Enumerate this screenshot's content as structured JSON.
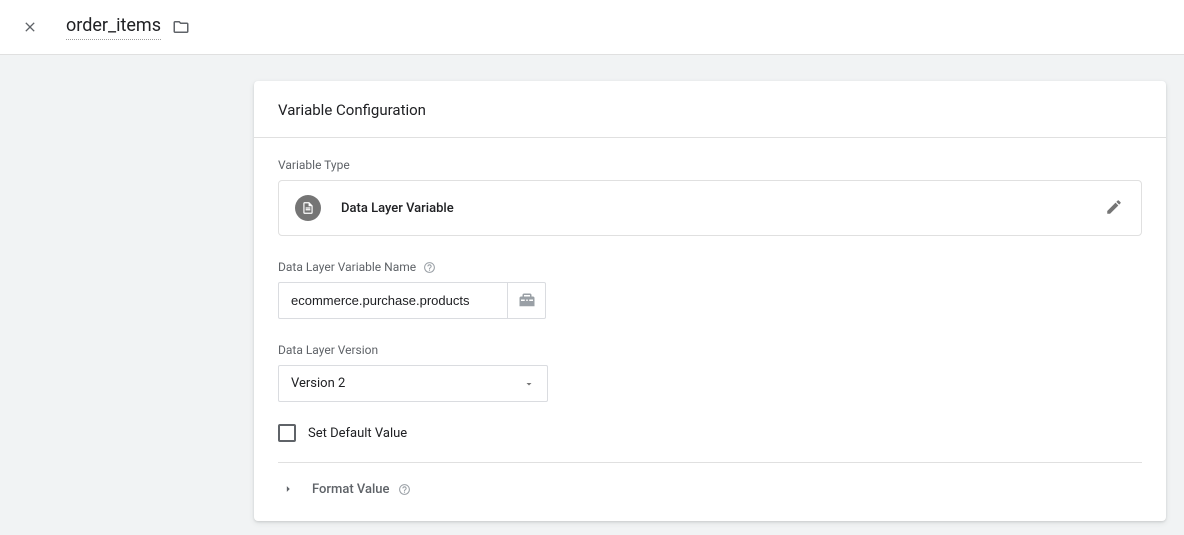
{
  "header": {
    "title": "order_items"
  },
  "card": {
    "title": "Variable Configuration",
    "variableTypeLabel": "Variable Type",
    "variableTypeName": "Data Layer Variable",
    "nameField": {
      "label": "Data Layer Variable Name",
      "value": "ecommerce.purchase.products"
    },
    "versionField": {
      "label": "Data Layer Version",
      "value": "Version 2"
    },
    "setDefaultLabel": "Set Default Value",
    "formatValueLabel": "Format Value"
  }
}
